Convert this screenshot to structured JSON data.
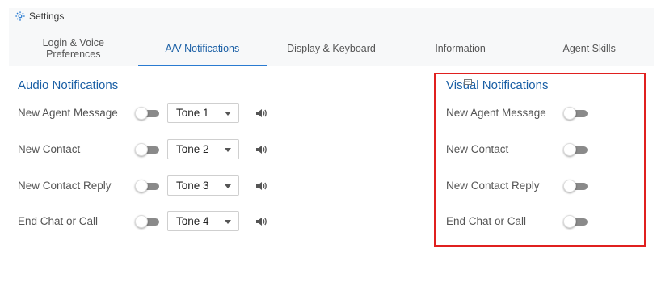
{
  "header": {
    "title": "Settings",
    "icon": "gear-icon"
  },
  "tabs": [
    {
      "label": "Login & Voice Preferences",
      "line1": "Login & Voice",
      "line2": "Preferences",
      "active": false
    },
    {
      "label": "A/V Notifications",
      "active": true
    },
    {
      "label": "Display & Keyboard",
      "active": false
    },
    {
      "label": "Information",
      "active": false
    },
    {
      "label": "Agent Skills",
      "active": false
    }
  ],
  "audio": {
    "title": "Audio Notifications",
    "rows": [
      {
        "label": "New Agent Message",
        "tone": "Tone 1",
        "enabled": false
      },
      {
        "label": "New Contact",
        "tone": "Tone 2",
        "enabled": false
      },
      {
        "label": "New Contact Reply",
        "tone": "Tone 3",
        "enabled": false
      },
      {
        "label": "End Chat or Call",
        "tone": "Tone 4",
        "enabled": false
      }
    ]
  },
  "visual": {
    "title": "Visual Notifications",
    "rows": [
      {
        "label": "New Agent Message",
        "enabled": false
      },
      {
        "label": "New Contact",
        "enabled": false
      },
      {
        "label": "New Contact Reply",
        "enabled": false
      },
      {
        "label": "End Chat or Call",
        "enabled": false
      }
    ]
  },
  "colors": {
    "accent": "#1a5fa5",
    "highlight": "#e0201f",
    "toggle_track": "#8a8a8a"
  }
}
